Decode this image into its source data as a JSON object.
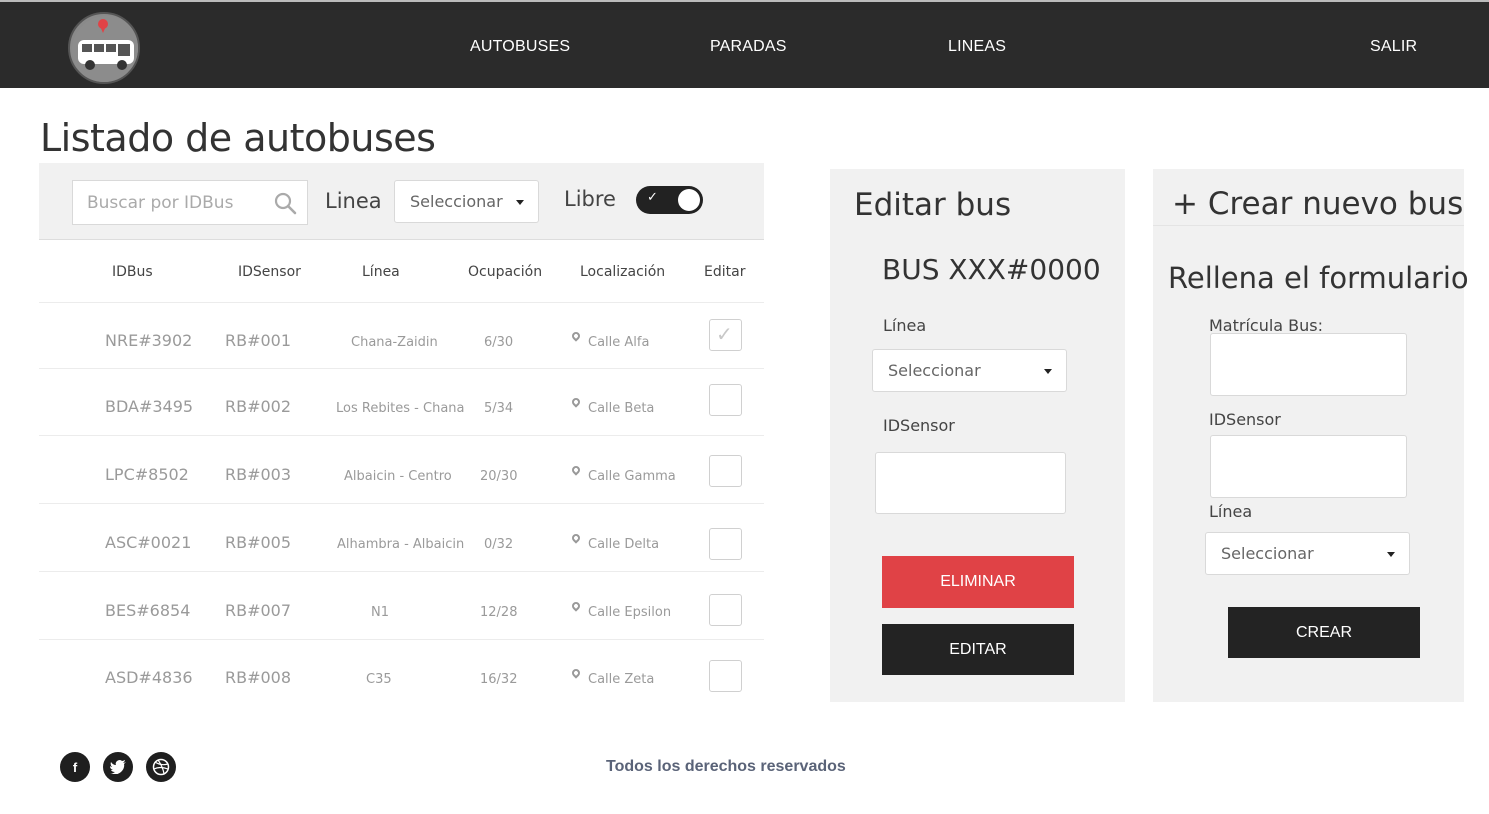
{
  "nav": {
    "links": [
      "AUTOBUSES",
      "PARADAS",
      "LINEAS",
      "SALIR"
    ]
  },
  "page_title": "Listado de autobuses",
  "filters": {
    "search_placeholder": "Buscar por IDBus",
    "linea_label": "Linea",
    "linea_select": "Seleccionar",
    "libre_label": "Libre",
    "libre_on": true
  },
  "table": {
    "headers": [
      "IDBus",
      "IDSensor",
      "Línea",
      "Ocupación",
      "Localización",
      "Editar"
    ],
    "rows": [
      {
        "idbus": "NRE#3902",
        "idsensor": "RB#001",
        "linea": "Chana-Zaidin",
        "ocupacion": "6/30",
        "localizacion": "Calle Alfa",
        "checked": true
      },
      {
        "idbus": "BDA#3495",
        "idsensor": "RB#002",
        "linea": "Los Rebites - Chana",
        "ocupacion": "5/34",
        "localizacion": "Calle Beta",
        "checked": false
      },
      {
        "idbus": "LPC#8502",
        "idsensor": "RB#003",
        "linea": "Albaicin - Centro",
        "ocupacion": "20/30",
        "localizacion": "Calle Gamma",
        "checked": false
      },
      {
        "idbus": "ASC#0021",
        "idsensor": "RB#005",
        "linea": "Alhambra - Albaicin",
        "ocupacion": "0/32",
        "localizacion": "Calle  Delta",
        "checked": false
      },
      {
        "idbus": "BES#6854",
        "idsensor": "RB#007",
        "linea": "N1",
        "ocupacion": "12/28",
        "localizacion": "Calle Epsilon",
        "checked": false
      },
      {
        "idbus": "ASD#4836",
        "idsensor": "RB#008",
        "linea": "C35",
        "ocupacion": "16/32",
        "localizacion": "Calle Zeta",
        "checked": false
      }
    ]
  },
  "edit_panel": {
    "title": "Editar bus",
    "bus_id": "BUS XXX#0000",
    "linea_label": "Línea",
    "linea_select": "Seleccionar",
    "sensor_label": "IDSensor",
    "delete_button": "ELIMINAR",
    "edit_button": "EDITAR"
  },
  "create_panel": {
    "title": "+ Crear nuevo bus",
    "subtitle": "Rellena el formulario",
    "matricula_label": "Matrícula Bus:",
    "sensor_label": "IDSensor",
    "linea_label": "Línea",
    "linea_select": "Seleccionar",
    "create_button": "CREAR"
  },
  "footer": {
    "social": [
      "f",
      "t",
      "d"
    ],
    "rights": "Todos los derechos reservados"
  },
  "colors": {
    "topbar": "#2b2b2b",
    "danger": "#e04246",
    "dark_button": "#232323",
    "panel_bg": "#f1f1f1"
  }
}
